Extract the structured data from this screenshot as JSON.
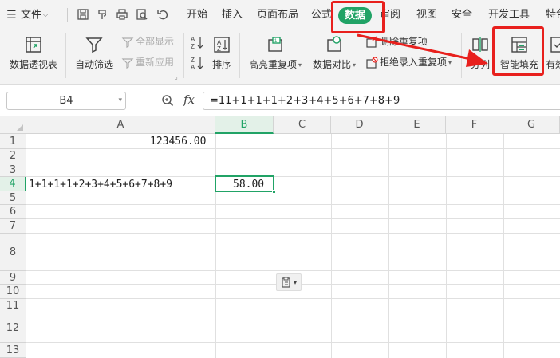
{
  "menubar": {
    "file": "文件",
    "tabs": [
      "开始",
      "插入",
      "页面布局",
      "公式",
      "数据",
      "审阅",
      "视图",
      "安全",
      "开发工具",
      "特色"
    ],
    "active_tab": "数据",
    "active_color": "#21a366"
  },
  "ribbon": {
    "pivot": "数据透视表",
    "autofilter": "自动筛选",
    "show_all": "全部显示",
    "reapply": "重新应用",
    "sort": "排序",
    "highlight_dup": "高亮重复项",
    "compare": "数据对比",
    "delete_dup": "删除重复项",
    "reject_dup": "拒绝录入重复项",
    "split": "分列",
    "smart_fill": "智能填充",
    "valid": "有效"
  },
  "formula_bar": {
    "name_box": "B4",
    "fx": "fx",
    "formula": "=11+1+1+1+2+3+4+5+6+7+8+9"
  },
  "grid": {
    "columns": [
      "A",
      "B",
      "C",
      "D",
      "E",
      "F",
      "G"
    ],
    "selected_column": "B",
    "rows": [
      "1",
      "2",
      "3",
      "4",
      "5",
      "6",
      "7",
      "8",
      "9",
      "10",
      "11",
      "12",
      "13"
    ],
    "selected_row": "4",
    "cells": {
      "A1": "123456.00",
      "A4": "1+1+1+1+2+3+4+5+6+7+8+9",
      "B4": "58.00"
    },
    "selected_cell": "B4"
  },
  "annotation_color": "#e8201d"
}
